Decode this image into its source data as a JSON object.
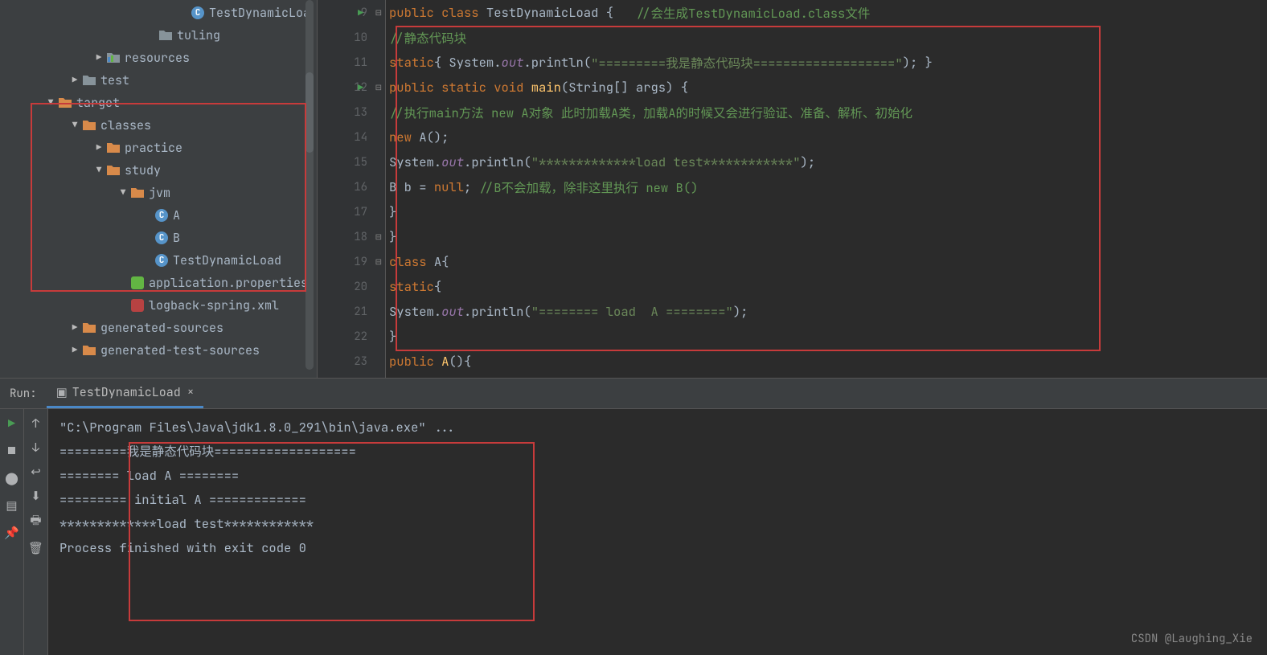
{
  "tree": {
    "items": [
      {
        "indent": 220,
        "arrow": "",
        "icon": "class",
        "label": "TestDynamicLoa"
      },
      {
        "indent": 180,
        "arrow": "",
        "icon": "folder-g",
        "label": "tuling"
      },
      {
        "indent": 115,
        "arrow": "▶",
        "icon": "res",
        "label": "resources"
      },
      {
        "indent": 85,
        "arrow": "▶",
        "icon": "folder-g",
        "label": "test"
      },
      {
        "indent": 55,
        "arrow": "▼",
        "icon": "folder-o",
        "label": "target"
      },
      {
        "indent": 85,
        "arrow": "▼",
        "icon": "folder-o",
        "label": "classes"
      },
      {
        "indent": 115,
        "arrow": "▶",
        "icon": "folder-o",
        "label": "practice"
      },
      {
        "indent": 115,
        "arrow": "▼",
        "icon": "folder-o",
        "label": "study"
      },
      {
        "indent": 145,
        "arrow": "▼",
        "icon": "folder-o",
        "label": "jvm"
      },
      {
        "indent": 175,
        "arrow": "",
        "icon": "class",
        "label": "A"
      },
      {
        "indent": 175,
        "arrow": "",
        "icon": "class",
        "label": "B"
      },
      {
        "indent": 175,
        "arrow": "",
        "icon": "class",
        "label": "TestDynamicLoad"
      },
      {
        "indent": 145,
        "arrow": "",
        "icon": "prop",
        "label": "application.properties"
      },
      {
        "indent": 145,
        "arrow": "",
        "icon": "xml",
        "label": "logback-spring.xml"
      },
      {
        "indent": 85,
        "arrow": "▶",
        "icon": "folder-o",
        "label": "generated-sources"
      },
      {
        "indent": 85,
        "arrow": "▶",
        "icon": "folder-o",
        "label": "generated-test-sources"
      }
    ]
  },
  "editor": {
    "lines": [
      9,
      10,
      11,
      12,
      13,
      14,
      15,
      16,
      17,
      18,
      19,
      20,
      21,
      22,
      23
    ],
    "code": {
      "l9": {
        "p1": "public class ",
        "p2": "TestDynamicLoad",
        "p3": " {   ",
        "p4": "//会生成TestDynamicLoad.class文件"
      },
      "l10": {
        "p1": "//静态代码块"
      },
      "l11": {
        "p1": "static",
        "p2": "{ System.",
        "p3": "out",
        "p4": ".println(",
        "p5": "\"=========我是静态代码块===================\"",
        "p6": "); }"
      },
      "l12": {
        "p1": "public static void ",
        "p2": "main",
        "p3": "(String[] args) {"
      },
      "l13": {
        "p1": "//执行main方法 new A对象 此时加载A类，加载A的时候又会进行验证、准备、解析、初始化"
      },
      "l14": {
        "p1": "new ",
        "p2": "A();"
      },
      "l15": {
        "p1": "System.",
        "p2": "out",
        "p3": ".println(",
        "p4": "\"*************load test************\"",
        "p5": ");"
      },
      "l16": {
        "p1": "B b = ",
        "p2": "null",
        "p3": "; ",
        "p4": "//B不会加载，除非这里执行 new B()"
      },
      "l17": {
        "p1": "}"
      },
      "l18": {
        "p1": "}"
      },
      "l19": {
        "p1": "class ",
        "p2": "A",
        "p3": "{"
      },
      "l20": {
        "p1": "static",
        "p2": "{"
      },
      "l21": {
        "p1": "System.",
        "p2": "out",
        "p3": ".println(",
        "p4": "\"======== load  A ========\"",
        "p5": ");"
      },
      "l22": {
        "p1": "}"
      },
      "l23": {
        "p1": "public ",
        "p2": "A",
        "p3": "(){"
      }
    }
  },
  "run": {
    "label": "Run:",
    "tab": "TestDynamicLoad",
    "lines": [
      "\"C:\\Program Files\\Java\\jdk1.8.0_291\\bin\\java.exe\" ...",
      "=========我是静态代码块===================",
      "======== load  A ========",
      "========= initial A =============",
      "*************load test************",
      "",
      "Process finished with exit code 0"
    ]
  },
  "watermark": "CSDN @Laughing_Xie"
}
